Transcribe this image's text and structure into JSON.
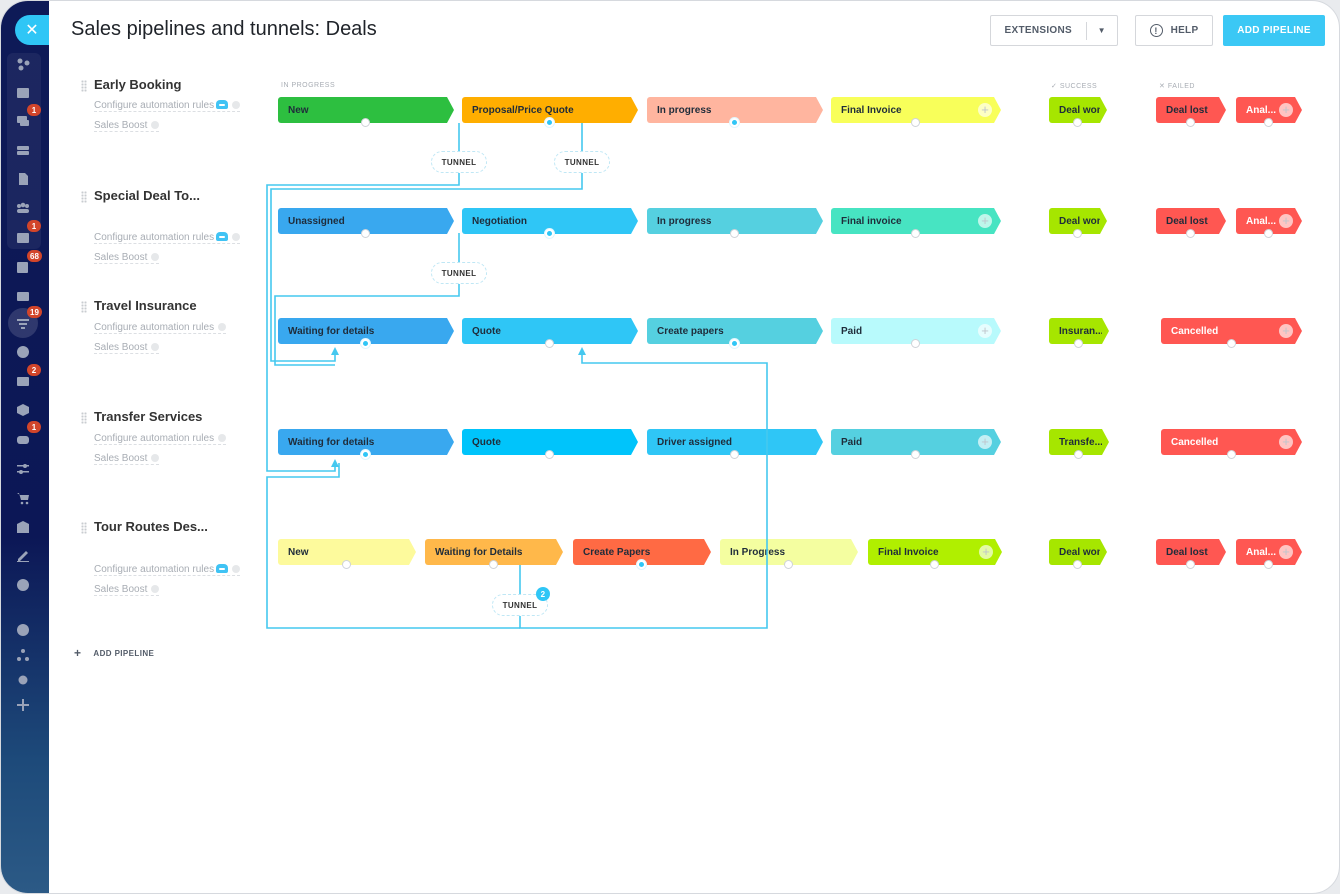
{
  "header": {
    "title": "Sales pipelines and tunnels: Deals",
    "extensions_label": "EXTENSIONS",
    "help_label": "HELP",
    "add_pipeline_label": "ADD PIPELINE"
  },
  "sidebar": {
    "close_icon": "close-icon",
    "items": [
      {
        "icon": "crm-icon",
        "badge": null
      },
      {
        "icon": "window-icon",
        "badge": null
      },
      {
        "icon": "chat-icon",
        "badge": "1"
      },
      {
        "icon": "drive-icon",
        "badge": null
      },
      {
        "icon": "document-icon",
        "badge": null
      },
      {
        "icon": "group-icon",
        "badge": null
      },
      {
        "icon": "calendar-icon",
        "badge": "1"
      },
      {
        "icon": "tasks-icon",
        "badge": "68"
      },
      {
        "icon": "contact-card-icon",
        "badge": null
      },
      {
        "icon": "funnel-icon",
        "badge": "19",
        "active": true
      },
      {
        "icon": "target-icon",
        "badge": null
      },
      {
        "icon": "mail-icon",
        "badge": "2"
      },
      {
        "icon": "box-icon",
        "badge": null
      },
      {
        "icon": "robot-icon",
        "badge": "1"
      },
      {
        "icon": "sliders-icon",
        "badge": null
      },
      {
        "icon": "cart-icon",
        "badge": null
      },
      {
        "icon": "bank-icon",
        "badge": null
      },
      {
        "icon": "signature-icon",
        "badge": null
      },
      {
        "icon": "more-icon",
        "badge": null
      },
      {
        "icon": "help-icon",
        "badge": null
      },
      {
        "icon": "structure-icon",
        "badge": null
      },
      {
        "icon": "settings-icon",
        "badge": null
      },
      {
        "icon": "plus-icon",
        "badge": null
      }
    ]
  },
  "sections": {
    "in_progress": "IN PROGRESS",
    "success": "SUCCESS",
    "failed": "FAILED"
  },
  "pipeline_links": {
    "automation": "Configure automation rules",
    "boost": "Sales Boost"
  },
  "tunnel_label": "TUNNEL",
  "tunnel_count": "2",
  "add_pipeline_bottom": "ADD PIPELINE",
  "pipelines": [
    {
      "name": "Early Booking",
      "robot": true,
      "stages": [
        {
          "label": "New",
          "color": "#2dbf40",
          "active": false
        },
        {
          "label": "Proposal/Price Quote",
          "color": "#ffae00",
          "active": true
        },
        {
          "label": "In progress",
          "color": "#ffb59f",
          "active": true
        },
        {
          "label": "Final Invoice",
          "color": "#f8ff5a",
          "active": false,
          "plus": true
        }
      ],
      "success": [
        {
          "label": "Deal won",
          "color": "#a6e600"
        }
      ],
      "failed": [
        {
          "label": "Deal lost",
          "color": "#ff5752"
        },
        {
          "label": "Anal...",
          "color": "#ff5752",
          "plus": true
        }
      ]
    },
    {
      "name": "Special Deal To...",
      "robot": true,
      "stages": [
        {
          "label": "Unassigned",
          "color": "#39a8ef",
          "active": false
        },
        {
          "label": "Negotiation",
          "color": "#2fc6f6",
          "active": true
        },
        {
          "label": "In progress",
          "color": "#55d0e0",
          "active": false
        },
        {
          "label": "Final invoice",
          "color": "#47e4c2",
          "active": false,
          "plus": true
        }
      ],
      "success": [
        {
          "label": "Deal won",
          "color": "#a6e600"
        }
      ],
      "failed": [
        {
          "label": "Deal lost",
          "color": "#ff5752"
        },
        {
          "label": "Anal...",
          "color": "#ff5752",
          "plus": true
        }
      ]
    },
    {
      "name": "Travel Insurance",
      "robot": false,
      "stages": [
        {
          "label": "Waiting for details",
          "color": "#39a8ef",
          "active": true
        },
        {
          "label": "Quote",
          "color": "#2fc6f6",
          "active": false
        },
        {
          "label": "Create papers",
          "color": "#55d0e0",
          "active": true
        },
        {
          "label": "Paid",
          "color": "#b8fafc",
          "active": false,
          "plus": true
        }
      ],
      "success": [
        {
          "label": "Insuran...",
          "color": "#a6e600"
        }
      ],
      "failed": [
        {
          "label": "Cancelled",
          "color": "#ff5752",
          "plus": true
        }
      ]
    },
    {
      "name": "Transfer Services",
      "robot": false,
      "stages": [
        {
          "label": "Waiting for details",
          "color": "#39a8ef",
          "active": true
        },
        {
          "label": "Quote",
          "color": "#00c4fb",
          "active": false
        },
        {
          "label": "Driver assigned",
          "color": "#2fc6f6",
          "active": false
        },
        {
          "label": "Paid",
          "color": "#55d0e0",
          "active": false,
          "plus": true
        }
      ],
      "success": [
        {
          "label": "Transfe...",
          "color": "#a6e600"
        }
      ],
      "failed": [
        {
          "label": "Cancelled",
          "color": "#ff5752",
          "plus": true
        }
      ]
    },
    {
      "name": "Tour Routes Des...",
      "robot": true,
      "stages": [
        {
          "label": "New",
          "color": "#fdfa9c",
          "active": false
        },
        {
          "label": "Waiting for Details",
          "color": "#ffb84a",
          "active": false
        },
        {
          "label": "Create Papers",
          "color": "#ff6a44",
          "active": true
        },
        {
          "label": "In Progress",
          "color": "#f4fea0",
          "active": false
        },
        {
          "label": "Final Invoice",
          "color": "#b0ef00",
          "active": false,
          "plus": true
        }
      ],
      "success": [
        {
          "label": "Deal won",
          "color": "#a6e600"
        }
      ],
      "failed": [
        {
          "label": "Deal lost",
          "color": "#ff5752"
        },
        {
          "label": "Anal...",
          "color": "#ff5752",
          "plus": true
        }
      ]
    }
  ],
  "colors": {
    "accent": "#2fc6f6",
    "connector": "#45c8ef",
    "badge": "#d2452a"
  }
}
